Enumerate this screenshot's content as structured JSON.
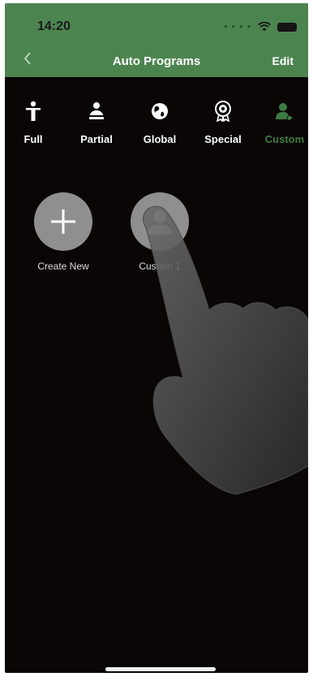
{
  "colors": {
    "accent": "#4c8450",
    "background": "#0b0606",
    "active_tab": "#3f7b44",
    "tile": "#8f8f8f"
  },
  "status": {
    "time": "14:20",
    "icons": [
      "signal-icon",
      "wifi-icon",
      "battery-icon"
    ]
  },
  "nav": {
    "back_icon": "chevron-left-icon",
    "title": "Auto Programs",
    "edit_label": "Edit"
  },
  "tabs": [
    {
      "label": "Full",
      "icon": "full-body-icon",
      "active": false
    },
    {
      "label": "Partial",
      "icon": "partial-body-icon",
      "active": false
    },
    {
      "label": "Global",
      "icon": "globe-icon",
      "active": false
    },
    {
      "label": "Special",
      "icon": "special-badge-icon",
      "active": false
    },
    {
      "label": "Custom",
      "icon": "custom-user-icon",
      "active": true
    }
  ],
  "programs": [
    {
      "label": "Create New",
      "icon": "plus-icon"
    },
    {
      "label": "Custom 1",
      "icon": "user-icon"
    }
  ],
  "overlay": {
    "icon": "pointing-hand-icon"
  }
}
